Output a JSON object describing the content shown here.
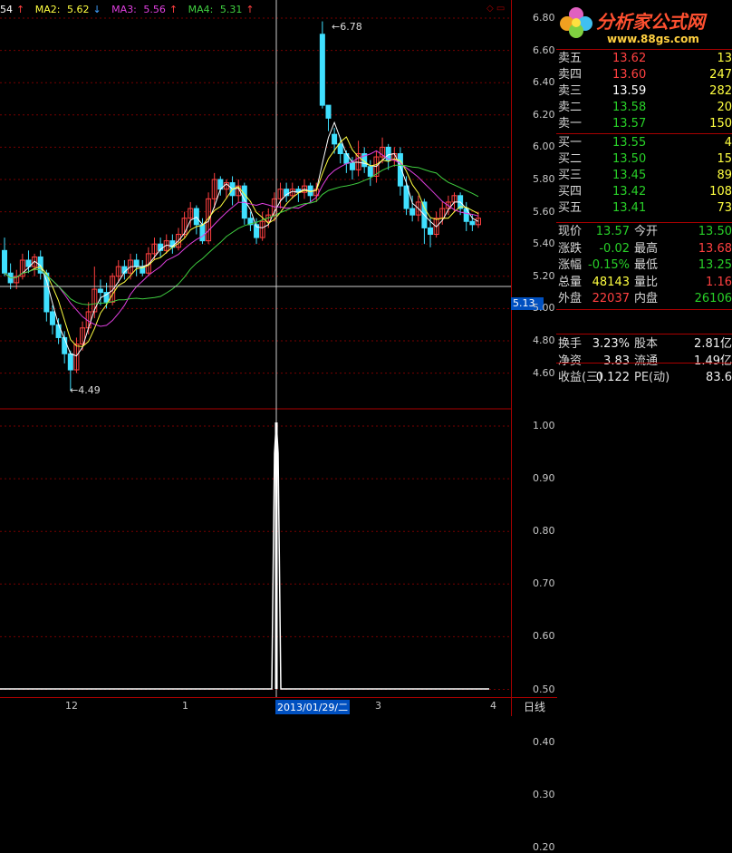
{
  "ma_legend": {
    "ma1": "54",
    "ma1_arrow": "↑",
    "ma2_label": "MA2:",
    "ma2_value": "5.62",
    "ma2_arrow": "↓",
    "ma3_label": "MA3:",
    "ma3_value": "5.56",
    "ma3_arrow": "↑",
    "ma4_label": "MA4:",
    "ma4_value": "5.31",
    "ma4_arrow": "↑",
    "colors": {
      "ma1": "#ffffff",
      "ma2": "#ffff40",
      "ma3": "#e040e0",
      "ma4": "#40d040"
    }
  },
  "price_axis": [
    "6.80",
    "6.60",
    "6.40",
    "6.20",
    "6.00",
    "5.80",
    "5.60",
    "5.40",
    "5.20",
    "5.00",
    "4.80",
    "4.60"
  ],
  "indicator_axis": [
    "1.00",
    "0.90",
    "0.80",
    "0.70",
    "0.60",
    "0.50",
    "0.40",
    "0.30",
    "0.20"
  ],
  "crosshair_price": "5.13",
  "annotations": {
    "high": "6.78",
    "low": "4.49"
  },
  "date_axis": {
    "d1": "12",
    "d2": "1",
    "selected": "2013/01/29/二",
    "d3": "3",
    "d4": "4"
  },
  "period": "日线",
  "logo": {
    "title": "分析家公式网",
    "url": "www.88gs.com"
  },
  "quote": {
    "asks": [
      {
        "label": "卖五",
        "price": "13.62",
        "vol": "13",
        "color": "#ff4040"
      },
      {
        "label": "卖四",
        "price": "13.60",
        "vol": "247",
        "color": "#ff4040"
      },
      {
        "label": "卖三",
        "price": "13.59",
        "vol": "282",
        "color": "#ffffff"
      },
      {
        "label": "卖二",
        "price": "13.58",
        "vol": "20",
        "color": "#28d028"
      },
      {
        "label": "卖一",
        "price": "13.57",
        "vol": "150",
        "color": "#28d028"
      }
    ],
    "bids": [
      {
        "label": "买一",
        "price": "13.55",
        "vol": "4",
        "color": "#28d028"
      },
      {
        "label": "买二",
        "price": "13.50",
        "vol": "15",
        "color": "#28d028"
      },
      {
        "label": "买三",
        "price": "13.45",
        "vol": "89",
        "color": "#28d028"
      },
      {
        "label": "买四",
        "price": "13.42",
        "vol": "108",
        "color": "#28d028"
      },
      {
        "label": "买五",
        "price": "13.41",
        "vol": "73",
        "color": "#28d028"
      }
    ],
    "stats": [
      {
        "l1": "现价",
        "v1": "13.57",
        "c1": "#28d028",
        "l2": "今开",
        "v2": "13.50",
        "c2": "#28d028"
      },
      {
        "l1": "涨跌",
        "v1": "-0.02",
        "c1": "#28d028",
        "l2": "最高",
        "v2": "13.68",
        "c2": "#ff4040"
      },
      {
        "l1": "涨幅",
        "v1": "-0.15%",
        "c1": "#28d028",
        "l2": "最低",
        "v2": "13.25",
        "c2": "#28d028"
      },
      {
        "l1": "总量",
        "v1": "48143",
        "c1": "#ffff40",
        "l2": "量比",
        "v2": "1.16",
        "c2": "#ff4040"
      },
      {
        "l1": "外盘",
        "v1": "22037",
        "c1": "#ff4040",
        "l2": "内盘",
        "v2": "26106",
        "c2": "#28d028"
      }
    ],
    "extra": [
      {
        "l1": "换手",
        "v1": "3.23%",
        "l2": "股本",
        "v2": "2.81亿"
      },
      {
        "l1": "净资",
        "v1": "3.83",
        "l2": "流通",
        "v2": "1.49亿"
      },
      {
        "l1": "收益(三)",
        "v1": "0.122",
        "l2": "PE(动)",
        "v2": "83.6"
      }
    ]
  },
  "candles": [
    [
      5.36,
      5.22,
      5.44,
      5.2
    ],
    [
      5.22,
      5.16,
      5.28,
      5.12
    ],
    [
      5.16,
      5.2,
      5.24,
      5.12
    ],
    [
      5.2,
      5.3,
      5.34,
      5.18
    ],
    [
      5.3,
      5.26,
      5.36,
      5.22
    ],
    [
      5.26,
      5.32,
      5.34,
      5.2
    ],
    [
      5.32,
      5.22,
      5.36,
      5.18
    ],
    [
      5.22,
      4.98,
      5.24,
      4.92
    ],
    [
      4.98,
      4.9,
      5.02,
      4.84
    ],
    [
      4.9,
      4.82,
      4.94,
      4.78
    ],
    [
      4.82,
      4.72,
      4.86,
      4.66
    ],
    [
      4.72,
      4.62,
      4.74,
      4.49
    ],
    [
      4.62,
      4.78,
      4.82,
      4.6
    ],
    [
      4.78,
      4.88,
      4.92,
      4.74
    ],
    [
      4.88,
      4.98,
      5.04,
      4.84
    ],
    [
      4.98,
      5.12,
      5.26,
      4.94
    ],
    [
      5.12,
      5.1,
      5.18,
      5.02
    ],
    [
      5.1,
      5.04,
      5.16,
      5.0
    ],
    [
      5.04,
      5.2,
      5.22,
      5.02
    ],
    [
      5.2,
      5.26,
      5.3,
      5.16
    ],
    [
      5.26,
      5.22,
      5.3,
      5.18
    ],
    [
      5.22,
      5.3,
      5.34,
      5.18
    ],
    [
      5.3,
      5.26,
      5.34,
      5.2
    ],
    [
      5.26,
      5.22,
      5.3,
      5.2
    ],
    [
      5.22,
      5.34,
      5.38,
      5.2
    ],
    [
      5.34,
      5.4,
      5.44,
      5.3
    ],
    [
      5.4,
      5.36,
      5.44,
      5.32
    ],
    [
      5.36,
      5.42,
      5.46,
      5.34
    ],
    [
      5.42,
      5.38,
      5.46,
      5.34
    ],
    [
      5.38,
      5.46,
      5.5,
      5.36
    ],
    [
      5.46,
      5.56,
      5.6,
      5.44
    ],
    [
      5.56,
      5.62,
      5.66,
      5.5
    ],
    [
      5.62,
      5.52,
      5.64,
      5.46
    ],
    [
      5.52,
      5.42,
      5.56,
      5.4
    ],
    [
      5.42,
      5.68,
      5.72,
      5.4
    ],
    [
      5.68,
      5.8,
      5.84,
      5.62
    ],
    [
      5.8,
      5.74,
      5.82,
      5.7
    ],
    [
      5.74,
      5.78,
      5.8,
      5.68
    ],
    [
      5.78,
      5.7,
      5.82,
      5.64
    ],
    [
      5.7,
      5.76,
      5.8,
      5.66
    ],
    [
      5.76,
      5.56,
      5.78,
      5.52
    ],
    [
      5.56,
      5.52,
      5.6,
      5.48
    ],
    [
      5.52,
      5.44,
      5.56,
      5.4
    ],
    [
      5.44,
      5.54,
      5.6,
      5.42
    ],
    [
      5.54,
      5.58,
      5.62,
      5.5
    ],
    [
      5.58,
      5.68,
      5.72,
      5.54
    ],
    [
      5.68,
      5.74,
      5.78,
      5.62
    ],
    [
      5.74,
      5.7,
      5.78,
      5.66
    ],
    [
      5.7,
      5.74,
      5.78,
      5.68
    ],
    [
      5.74,
      5.72,
      5.76,
      5.66
    ],
    [
      5.72,
      5.76,
      5.8,
      5.68
    ],
    [
      5.76,
      5.7,
      5.78,
      5.66
    ],
    [
      5.7,
      5.74,
      5.78,
      5.66
    ],
    [
      6.7,
      6.26,
      6.78,
      6.24
    ],
    [
      6.26,
      6.18,
      6.22,
      6.1
    ],
    [
      6.08,
      6.02,
      6.12,
      5.96
    ],
    [
      6.02,
      5.96,
      6.06,
      5.9
    ],
    [
      5.96,
      5.9,
      5.98,
      5.84
    ],
    [
      5.9,
      5.86,
      5.94,
      5.8
    ],
    [
      5.86,
      5.96,
      6.04,
      5.82
    ],
    [
      5.96,
      5.88,
      6.0,
      5.84
    ],
    [
      5.88,
      5.82,
      5.92,
      5.76
    ],
    [
      5.82,
      5.94,
      5.98,
      5.78
    ],
    [
      5.94,
      6.0,
      6.06,
      5.9
    ],
    [
      6.0,
      5.92,
      6.02,
      5.86
    ],
    [
      5.92,
      5.96,
      6.0,
      5.88
    ],
    [
      5.96,
      5.76,
      6.0,
      5.7
    ],
    [
      5.76,
      5.62,
      5.82,
      5.58
    ],
    [
      5.62,
      5.58,
      5.7,
      5.54
    ],
    [
      5.58,
      5.66,
      5.7,
      5.54
    ],
    [
      5.66,
      5.5,
      5.68,
      5.4
    ],
    [
      5.5,
      5.46,
      5.56,
      5.38
    ],
    [
      5.46,
      5.56,
      5.6,
      5.44
    ],
    [
      5.56,
      5.62,
      5.66,
      5.52
    ],
    [
      5.62,
      5.66,
      5.7,
      5.58
    ],
    [
      5.66,
      5.7,
      5.72,
      5.6
    ],
    [
      5.7,
      5.62,
      5.72,
      5.58
    ],
    [
      5.62,
      5.54,
      5.66,
      5.48
    ],
    [
      5.54,
      5.52,
      5.58,
      5.48
    ],
    [
      5.52,
      5.56,
      5.6,
      5.5
    ]
  ]
}
